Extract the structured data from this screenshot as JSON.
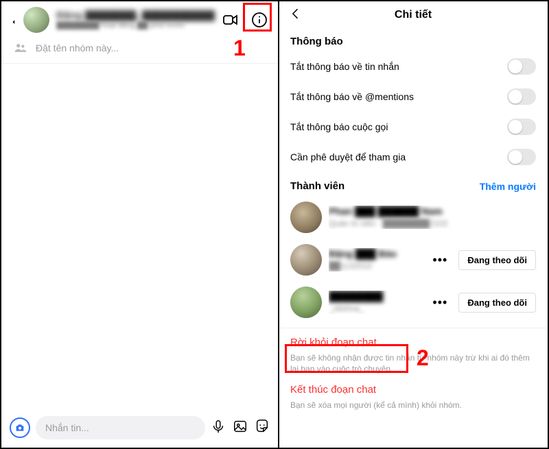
{
  "left": {
    "chat_title": "Đặng ███████, ██████████",
    "chat_subtitle": "████████ hoạt động ██ phút trước",
    "group_name_placeholder": "Đặt tên nhóm này...",
    "message_placeholder": "Nhắn tin...",
    "callout_number": "1"
  },
  "right": {
    "header_title": "Chi tiết",
    "section_notifications": "Thông báo",
    "toggles": {
      "mute_messages": "Tắt thông báo về tin nhắn",
      "mute_mentions": "Tắt thông báo về @mentions",
      "mute_calls": "Tắt thông báo cuộc gọi",
      "approve_join": "Cần phê duyệt để tham gia"
    },
    "members_title": "Thành viên",
    "add_member": "Thêm người",
    "members": [
      {
        "name": "Phan ███ ██████ Nam",
        "sub": "Quản trị viên · ████████2102"
      },
      {
        "name": "Đặng ███ Bảo",
        "sub": "██1132010"
      },
      {
        "name": "████████",
        "sub": "_olishna_"
      }
    ],
    "follow_label": "Đang theo dõi",
    "leave_chat": "Rời khỏi đoạn chat",
    "leave_hint": "Bạn sẽ không nhận được tin nhắn từ nhóm này trừ khi ai đó thêm lại bạn vào cuộc trò chuyện.",
    "end_chat": "Kết thúc đoạn chat",
    "end_hint": "Bạn sẽ xóa mọi người (kể cả mình) khỏi nhóm.",
    "callout_number": "2"
  }
}
